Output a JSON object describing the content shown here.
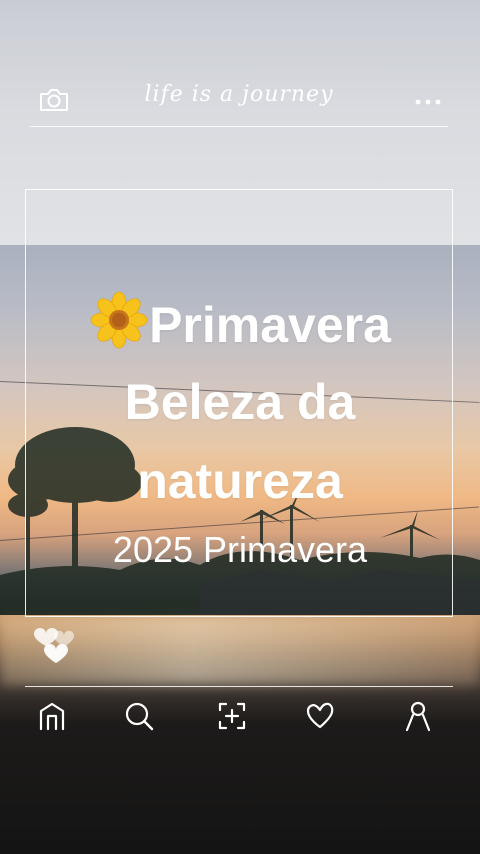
{
  "header": {
    "camera_icon": "camera-icon",
    "tagline": "life is a journey",
    "more_icon": "more-dots-icon"
  },
  "post": {
    "title_line1": "Primavera",
    "title_line2": "Beleza da",
    "title_line3": "natureza",
    "subtitle": "2025 Primavera",
    "flower_icon": "sunflower-icon"
  },
  "reactions": {
    "icon": "hearts-icon"
  },
  "nav": {
    "items": [
      {
        "icon": "home-icon"
      },
      {
        "icon": "search-icon"
      },
      {
        "icon": "add-icon"
      },
      {
        "icon": "heart-icon"
      },
      {
        "icon": "profile-icon"
      }
    ]
  },
  "colors": {
    "overlay_text": "#ffffff",
    "flower_petal": "#f7c21b",
    "flower_center": "#c8741a"
  }
}
